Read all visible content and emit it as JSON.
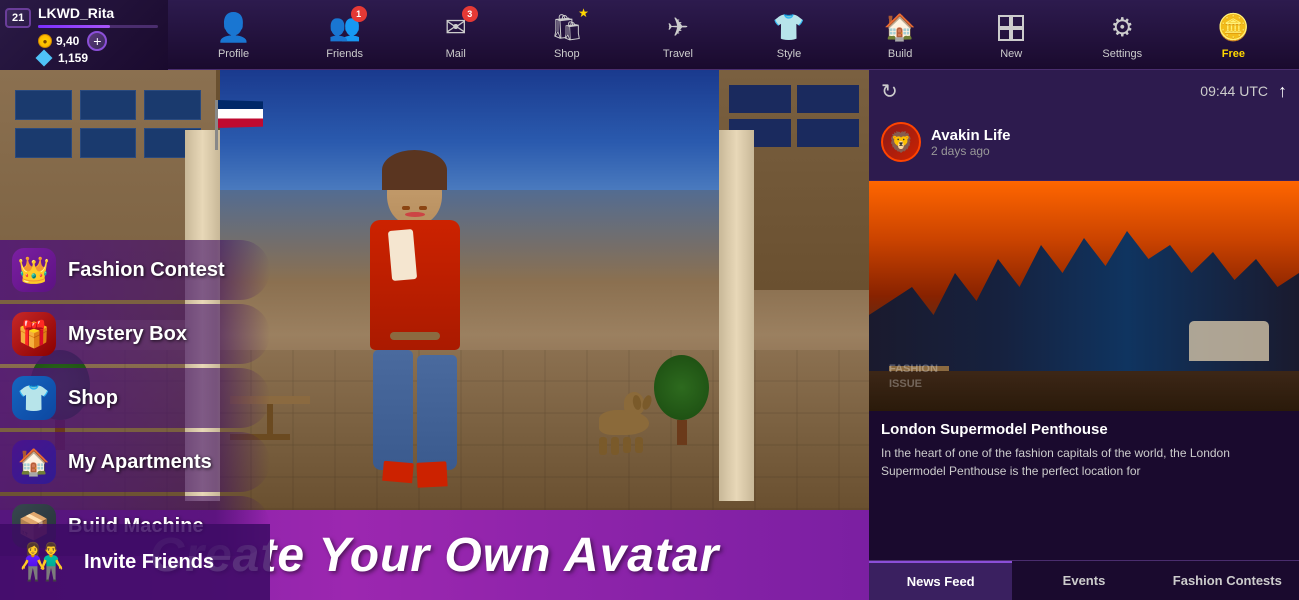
{
  "user": {
    "username": "LKWD_Rita",
    "level": 21,
    "xp_percent": 60,
    "coins": "9,40",
    "diamonds": "1,159"
  },
  "top_nav": {
    "items": [
      {
        "id": "profile",
        "label": "Profile",
        "icon": "👤",
        "badge": null
      },
      {
        "id": "friends",
        "label": "Friends",
        "icon": "👥",
        "badge": "1"
      },
      {
        "id": "mail",
        "label": "Mail",
        "icon": "✉",
        "badge": "3"
      },
      {
        "id": "shop",
        "label": "Shop",
        "icon": "🛍",
        "badge": null,
        "star": true
      },
      {
        "id": "travel",
        "label": "Travel",
        "icon": "✈",
        "badge": null
      },
      {
        "id": "style",
        "label": "Style",
        "icon": "👕",
        "badge": null
      },
      {
        "id": "build",
        "label": "Build",
        "icon": "🏠",
        "badge": null
      },
      {
        "id": "new",
        "label": "New",
        "icon": "⊞",
        "badge": null
      },
      {
        "id": "settings",
        "label": "Settings",
        "icon": "⚙",
        "badge": null
      },
      {
        "id": "free",
        "label": "Free",
        "icon": "💰",
        "badge": null
      }
    ]
  },
  "sidebar": {
    "items": [
      {
        "id": "fashion-contest",
        "label": "Fashion Contest",
        "icon": "👑",
        "color": "#8b4fd8"
      },
      {
        "id": "mystery-box",
        "label": "Mystery Box",
        "icon": "🎁",
        "color": "#e91e63"
      },
      {
        "id": "shop",
        "label": "Shop",
        "icon": "👕",
        "color": "#2196f3"
      },
      {
        "id": "my-apartments",
        "label": "My Apartments",
        "icon": "🏠",
        "color": "#673ab7"
      },
      {
        "id": "build-machine",
        "label": "Build Machine",
        "icon": "📦",
        "color": "#607d8b"
      }
    ],
    "invite": {
      "label": "Invite Friends",
      "icon": "👫"
    }
  },
  "right_panel": {
    "time": "09:44 UTC",
    "post": {
      "author": "Avakin Life",
      "avatar_icon": "🦁",
      "time_ago": "2 days ago",
      "image_overlay_line1": "FASHION",
      "image_overlay_line2": "ISSUE",
      "title": "London Supermodel Penthouse",
      "body": "In the heart of one of the fashion capitals of the world, the London Supermodel Penthouse is the perfect location for"
    },
    "tabs": [
      {
        "id": "news-feed",
        "label": "News Feed",
        "active": true
      },
      {
        "id": "events",
        "label": "Events",
        "active": false
      },
      {
        "id": "fashion-contests",
        "label": "Fashion Contests",
        "active": false
      }
    ]
  },
  "cta": {
    "text": "Create Your Own Avatar"
  }
}
